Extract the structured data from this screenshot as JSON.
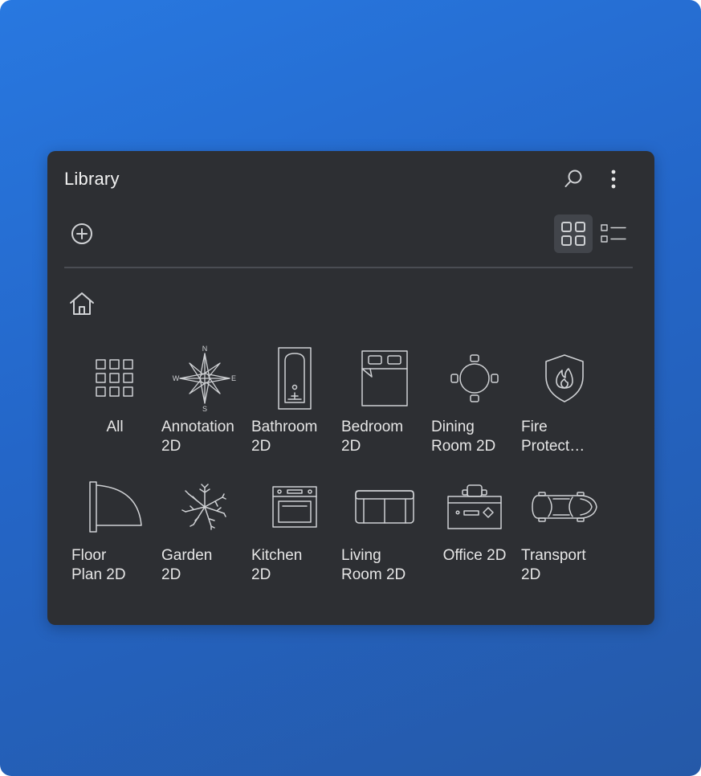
{
  "panel": {
    "title": "Library"
  },
  "toolbar": {
    "search_icon": "search-icon",
    "more_icon": "more-vertical-icon",
    "add_icon": "add-circle-icon",
    "grid_view_icon": "grid-view-icon",
    "list_view_icon": "list-view-icon",
    "active_view": "grid"
  },
  "breadcrumb": {
    "home_icon": "home-icon"
  },
  "categories": [
    {
      "label": "All",
      "icon": "apps-grid-icon"
    },
    {
      "label": "Annotation\n2D",
      "icon": "compass-rose-icon"
    },
    {
      "label": "Bathroom\n2D",
      "icon": "bathtub-icon"
    },
    {
      "label": "Bedroom\n2D",
      "icon": "bed-icon"
    },
    {
      "label": "Dining\nRoom 2D",
      "icon": "dining-table-icon"
    },
    {
      "label": "Fire\nProtect…",
      "icon": "fire-shield-icon"
    },
    {
      "label": "Floor\nPlan 2D",
      "icon": "door-swing-icon"
    },
    {
      "label": "Garden\n2D",
      "icon": "plant-icon"
    },
    {
      "label": "Kitchen\n2D",
      "icon": "oven-icon"
    },
    {
      "label": "Living\nRoom 2D",
      "icon": "sofa-icon"
    },
    {
      "label": "Office 2D",
      "icon": "office-desk-icon"
    },
    {
      "label": "Transport\n2D",
      "icon": "car-icon"
    }
  ],
  "compass": {
    "n": "N",
    "e": "E",
    "s": "S",
    "w": "W"
  },
  "colors": {
    "background_top": "#2878e0",
    "background_bottom": "#2559a8",
    "panel": "#2d2f33",
    "active_button": "#42454b",
    "icon_stroke": "#cfd1d4",
    "text": "#e6e6e6"
  }
}
